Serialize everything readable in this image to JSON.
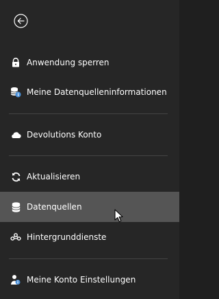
{
  "menu": {
    "items": [
      {
        "label": "Anwendung sperren",
        "icon": "lock-icon"
      },
      {
        "label": "Meine Datenquelleninformationen",
        "icon": "database-info-icon"
      },
      {
        "label": "Devolutions Konto",
        "icon": "cloud-icon"
      },
      {
        "label": "Aktualisieren",
        "icon": "refresh-icon"
      },
      {
        "label": "Datenquellen",
        "icon": "database-icon",
        "active": true
      },
      {
        "label": "Hintergrunddienste",
        "icon": "services-icon"
      },
      {
        "label": "Meine Konto Einstellungen",
        "icon": "user-settings-icon"
      }
    ]
  },
  "colors": {
    "panel_bg": "#262626",
    "active_bg": "#555555",
    "divider": "#444444",
    "text": "#ffffff",
    "accent_blue": "#4a90d9"
  }
}
